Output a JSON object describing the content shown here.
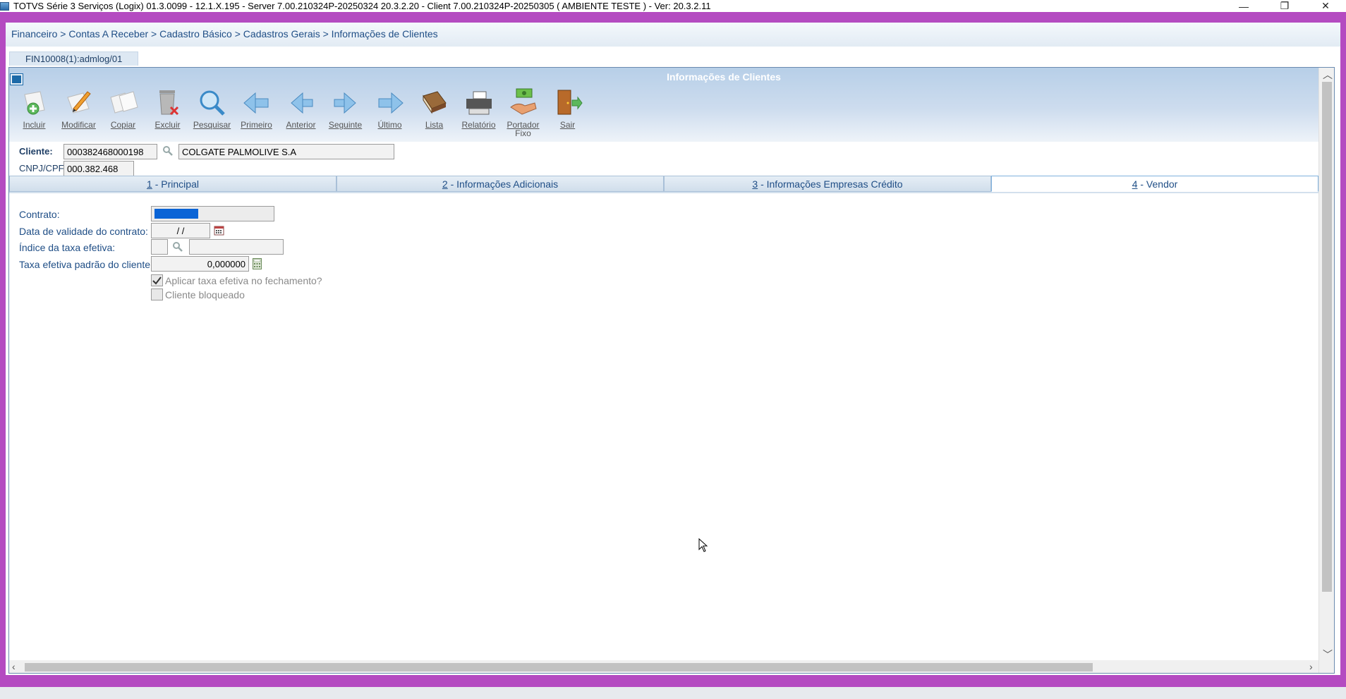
{
  "titlebar": {
    "title": "TOTVS Série 3 Serviços (Logix) 01.3.0099  -  12.1.X.195 - Server 7.00.210324P-20250324 20.3.2.20 - Client 7.00.210324P-20250305     ( AMBIENTE TESTE )  - Ver: 20.3.2.11",
    "minimize": "—",
    "restore": "❐",
    "close": "✕"
  },
  "breadcrumb": "Financeiro > Contas A Receber > Cadastro Básico > Cadastros Gerais > Informações de Clientes",
  "program_tab": "FIN10008(1):admlog/01",
  "window_title": "Informações de Clientes",
  "toolbar": [
    {
      "name": "incluir",
      "label": "Incluir",
      "icon": "add-document-icon"
    },
    {
      "name": "modificar",
      "label": "Modificar",
      "icon": "edit-document-icon"
    },
    {
      "name": "copiar",
      "label": "Copiar",
      "icon": "copy-document-icon"
    },
    {
      "name": "excluir",
      "label": "Excluir",
      "icon": "trash-icon"
    },
    {
      "name": "pesquisar",
      "label": "Pesquisar",
      "icon": "magnifier-icon"
    },
    {
      "name": "primeiro",
      "label": "Primeiro",
      "icon": "first-arrow-icon"
    },
    {
      "name": "anterior",
      "label": "Anterior",
      "icon": "previous-arrow-icon"
    },
    {
      "name": "seguinte",
      "label": "Seguinte",
      "icon": "next-arrow-icon"
    },
    {
      "name": "ultimo",
      "label": "Último",
      "icon": "last-arrow-icon"
    },
    {
      "name": "lista",
      "label": "Lista",
      "icon": "book-icon"
    },
    {
      "name": "relatorio",
      "label": "Relatório",
      "icon": "printer-icon"
    },
    {
      "name": "portador-fixo",
      "label": "Portador",
      "label2": "Fixo",
      "icon": "money-hand-icon"
    },
    {
      "name": "sair",
      "label": "Sair",
      "icon": "exit-door-icon"
    }
  ],
  "header_fields": {
    "cliente_label": "Cliente:",
    "cliente_code": "000382468000198",
    "cliente_name": "COLGATE PALMOLIVE S.A",
    "cnpj_label": "CNPJ/CPF:",
    "cnpj_value": "000.382.468"
  },
  "tabs": [
    {
      "num": "1",
      "label": " - Principal",
      "active": false
    },
    {
      "num": "2",
      "label": " - Informações Adicionais",
      "active": false
    },
    {
      "num": "3",
      "label": " - Informações Empresas Crédito",
      "active": false
    },
    {
      "num": "4",
      "label": " - Vendor",
      "active": true
    }
  ],
  "vendor": {
    "contrato_label": "Contrato:",
    "contrato_value": "",
    "data_validade_label": "Data de validade do contrato:",
    "data_validade_value": " /  /",
    "indice_label": "Índice da taxa efetiva:",
    "indice_code": "",
    "indice_desc": "",
    "taxa_label": "Taxa efetiva padrão do cliente:",
    "taxa_value": "0,000000",
    "aplicar_label": "Aplicar taxa efetiva no fechamento?",
    "aplicar_checked": true,
    "bloqueado_label": "Cliente bloqueado",
    "bloqueado_checked": false
  },
  "colors": {
    "frame": "#b44bc1",
    "accent_blue": "#1f4e86",
    "header_gradient_top": "#b7cfe8",
    "selection": "#0a64d6"
  }
}
